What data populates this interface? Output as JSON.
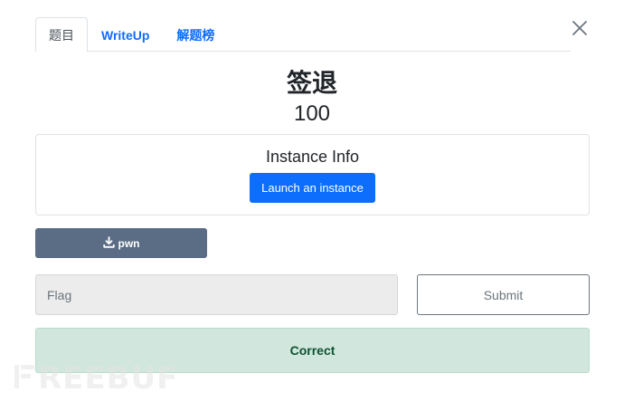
{
  "tabs": [
    {
      "label": "题目",
      "active": true
    },
    {
      "label": "WriteUp",
      "active": false
    },
    {
      "label": "解题榜",
      "active": false
    }
  ],
  "challenge": {
    "name": "签退",
    "points": "100"
  },
  "instance": {
    "title": "Instance Info",
    "launch_label": "Launch an instance"
  },
  "files": [
    {
      "label": "pwn",
      "icon": "download-icon"
    }
  ],
  "flag_form": {
    "placeholder": "Flag",
    "value": "",
    "submit_label": "Submit"
  },
  "result": {
    "message": "Correct"
  },
  "watermark": {
    "text": "REEBUF"
  },
  "colors": {
    "primary": "#0d6efd",
    "download_bg": "#5b6d84",
    "success_bg": "#d1e7dd",
    "success_text": "#0f5132"
  }
}
